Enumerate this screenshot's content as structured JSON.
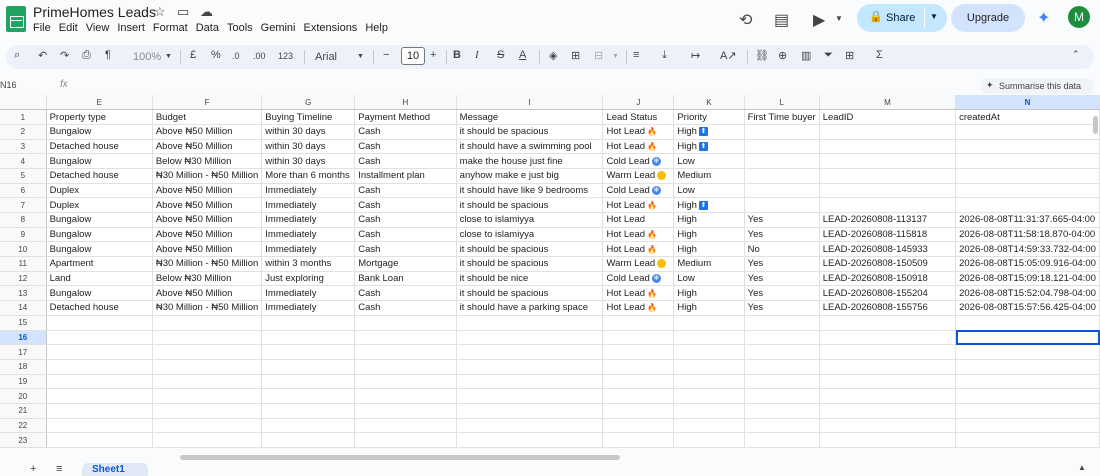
{
  "title_bar": {
    "doc_title": "PrimeHomes Leads",
    "menu": [
      "File",
      "Edit",
      "View",
      "Insert",
      "Format",
      "Data",
      "Tools",
      "Gemini",
      "Extensions",
      "Help"
    ],
    "share_label": "Share",
    "upgrade_label": "Upgrade",
    "avatar_initial": "M"
  },
  "toolbar": {
    "zoom": "100%",
    "currency": "£",
    "percent": "%",
    "decrease_decimals": ".0",
    "increase_decimals": ".00",
    "number_format": "123",
    "font": "Arial",
    "font_size": "10"
  },
  "formula_bar": {
    "name_box": "N16",
    "fx": "fx",
    "summarise_label": "Summarise this data"
  },
  "grid": {
    "columns": [
      "E",
      "F",
      "G",
      "H",
      "I",
      "J",
      "K",
      "L",
      "M",
      "N"
    ],
    "active_column": "N",
    "active_row": "16",
    "row_numbers": [
      "1",
      "2",
      "3",
      "4",
      "5",
      "6",
      "7",
      "8",
      "9",
      "10",
      "11",
      "12",
      "13",
      "14",
      "15",
      "16",
      "17",
      "18",
      "19",
      "20",
      "21",
      "22",
      "23"
    ],
    "rows": [
      [
        "Property type",
        "Budget",
        "Buying Timeline",
        "Payment Method",
        "Message",
        "Lead Status",
        "Priority",
        "First Time buyer",
        "LeadID",
        "createdAt"
      ],
      [
        "Bungalow",
        "Above ₦50 Million",
        "within 30 days",
        "Cash",
        "it should be spacious",
        "Hot Lead",
        "High",
        "",
        "",
        ""
      ],
      [
        "Detached house",
        "Above ₦50 Million",
        "within 30 days",
        "Cash",
        "it should have a swimming pool",
        "Hot Lead",
        "High",
        "",
        "",
        ""
      ],
      [
        "Bungalow",
        "Below ₦30 Million",
        "within 30 days",
        "Cash",
        "make the house just fine",
        "Cold Lead",
        "Low",
        "",
        "",
        ""
      ],
      [
        "Detached house",
        "₦30 Million - ₦50 Million",
        "More than 6 months",
        "Installment plan",
        "anyhow make e just big",
        "Warm Lead",
        "Medium",
        "",
        "",
        ""
      ],
      [
        "Duplex",
        "Above ₦50 Million",
        "Immediately",
        "Cash",
        "it should have like 9 bedrooms",
        "Cold Lead",
        "Low",
        "",
        "",
        ""
      ],
      [
        "Duplex",
        "Above ₦50 Million",
        "Immediately",
        "Cash",
        "it should be spacious",
        "Hot Lead",
        "High",
        "",
        "",
        ""
      ],
      [
        "Bungalow",
        "Above ₦50 Million",
        "Immediately",
        "Cash",
        "close to islamiyya",
        "Hot Lead",
        "High",
        "Yes",
        "LEAD-20260808-113137",
        "2026-08-08T11:31:37.665-04:00"
      ],
      [
        "Bungalow",
        "Above ₦50 Million",
        "Immediately",
        "Cash",
        "close to islamiyya",
        "Hot Lead",
        "High",
        "Yes",
        "LEAD-20260808-115818",
        "2026-08-08T11:58:18.870-04:00"
      ],
      [
        "Bungalow",
        "Above ₦50 Million",
        "Immediately",
        "Cash",
        "it should be spacious",
        "Hot Lead",
        "High",
        "No",
        "LEAD-20260808-145933",
        "2026-08-08T14:59:33.732-04:00"
      ],
      [
        "Apartment",
        "₦30 Million - ₦50 Million",
        "within 3 months",
        "Mortgage",
        "it should be spacious",
        "Warm Lead",
        "Medium",
        "Yes",
        "LEAD-20260808-150509",
        "2026-08-08T15:05:09.916-04:00"
      ],
      [
        "Land",
        "Below ₦30 Million",
        "Just exploring",
        "Bank Loan",
        "it should be nice",
        "Cold Lead",
        "Low",
        "Yes",
        "LEAD-20260808-150918",
        "2026-08-08T15:09:18.121-04:00"
      ],
      [
        "Bungalow",
        "Above ₦50 Million",
        "Immediately",
        "Cash",
        "it should be spacious",
        "Hot Lead",
        "High",
        "Yes",
        "LEAD-20260808-155204",
        "2026-08-08T15:52:04.798-04:00"
      ],
      [
        "Detached house",
        "₦30 Million - ₦50 Million",
        "Immediately",
        "Cash",
        "it should have a parking space",
        "Hot Lead",
        "High",
        "Yes",
        "LEAD-20260808-155756",
        "2026-08-08T15:57:56.425-04:00"
      ]
    ],
    "status_icons": {
      "2": [
        "fire",
        "up"
      ],
      "3": [
        "fire",
        "up"
      ],
      "4": [
        "snow",
        null
      ],
      "5": [
        "sun",
        null
      ],
      "6": [
        "snow",
        null
      ],
      "7": [
        "fire",
        "up"
      ],
      "8": [
        null,
        null
      ],
      "9": [
        "fire",
        null
      ],
      "10": [
        "fire",
        null
      ],
      "11": [
        "sun",
        null
      ],
      "12": [
        "snow",
        null
      ],
      "13": [
        "fire",
        null
      ],
      "14": [
        "fire",
        null
      ]
    }
  },
  "bottom": {
    "sheet_tab": "Sheet1"
  },
  "colors": {
    "accent": "#0b57d0",
    "share_bg": "#c2e7ff",
    "logo_green": "#1fa463"
  }
}
